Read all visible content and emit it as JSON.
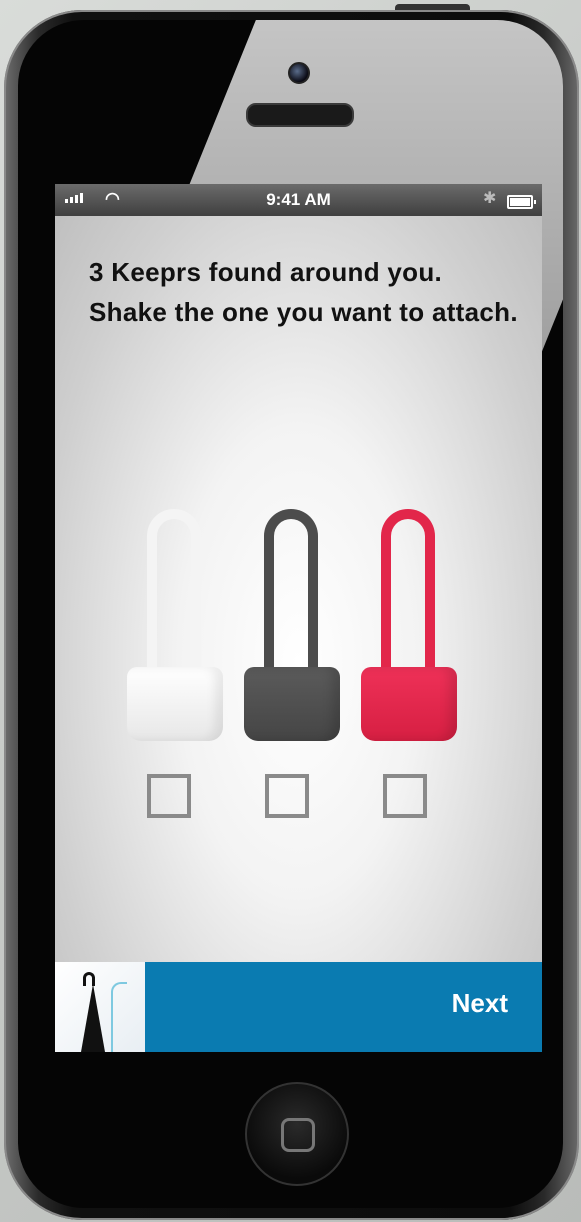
{
  "status_bar": {
    "time": "9:41 AM",
    "wifi_icon": "wifi-icon",
    "bluetooth_icon": "bluetooth-icon",
    "battery_icon": "battery-icon"
  },
  "headline": {
    "line1": "3 Keeprs found around you.",
    "line2": "Shake the one you want to attach."
  },
  "keepers": [
    {
      "color": "#f4f4f4",
      "name": "white"
    },
    {
      "color": "#4c4c4c",
      "name": "grey"
    },
    {
      "color": "#e2264a",
      "name": "red"
    }
  ],
  "bottom_bar": {
    "next_label": "Next",
    "accent": "#0a7bb1",
    "thumbnail_icon": "umbrella-thumbnail"
  }
}
